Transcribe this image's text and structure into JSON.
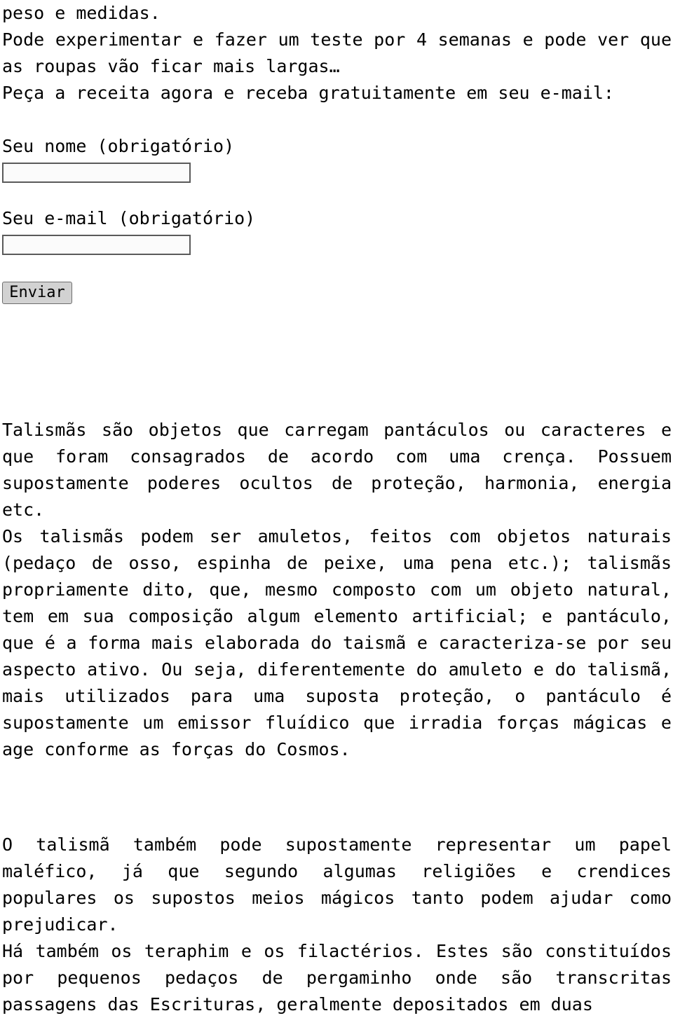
{
  "document": {
    "intro": {
      "line_1": "peso e medidas.",
      "line_2": "Pode experimentar e fazer um teste por 4 semanas e pode ver que as roupas vão ficar mais largas…",
      "line_3": "Peça a receita agora e receba gratuitamente em seu e-mail:"
    },
    "form": {
      "name_label": "Seu nome (obrigatório)",
      "name_value": "",
      "name_placeholder": "",
      "email_label": "Seu e-mail (obrigatório)",
      "email_value": "",
      "email_placeholder": "",
      "submit_label": "Enviar"
    },
    "article": {
      "paragraph_1": "Talismãs são objetos que carregam pantáculos ou caracteres e que foram consagrados de acordo com uma crença. Possuem supostamente poderes ocultos de proteção, harmonia, energia etc.",
      "paragraph_2": "Os talismãs podem ser amuletos, feitos com objetos naturais (pedaço de osso, espinha de peixe, uma pena etc.); talismãs propriamente dito, que, mesmo composto com um objeto natural, tem em sua composição algum elemento artificial; e pantáculo, que é a forma mais elaborada do taismã e caracteriza-se por seu aspecto ativo. Ou seja, diferentemente do amuleto e do talismã, mais utilizados para uma suposta proteção, o pantáculo é supostamente um emissor fluídico que irradia forças mágicas e age conforme as forças do Cosmos.",
      "paragraph_3": "O talismã também pode supostamente representar um papel maléfico, já que segundo algumas religiões e crendices populares os supostos meios mágicos tanto podem ajudar como prejudicar.",
      "paragraph_4": "Há também os teraphim e os filactérios. Estes são constituídos por pequenos pedaços de pergaminho onde são transcritas passagens das Escrituras, geralmente depositados em duas"
    },
    "colors": {
      "background": "#ffffff",
      "text": "#000000",
      "input_border": "#5a5a5a",
      "input_background": "#fbfbfb",
      "button_background": "#d2d2d2",
      "button_border": "#6e6e6e"
    }
  }
}
